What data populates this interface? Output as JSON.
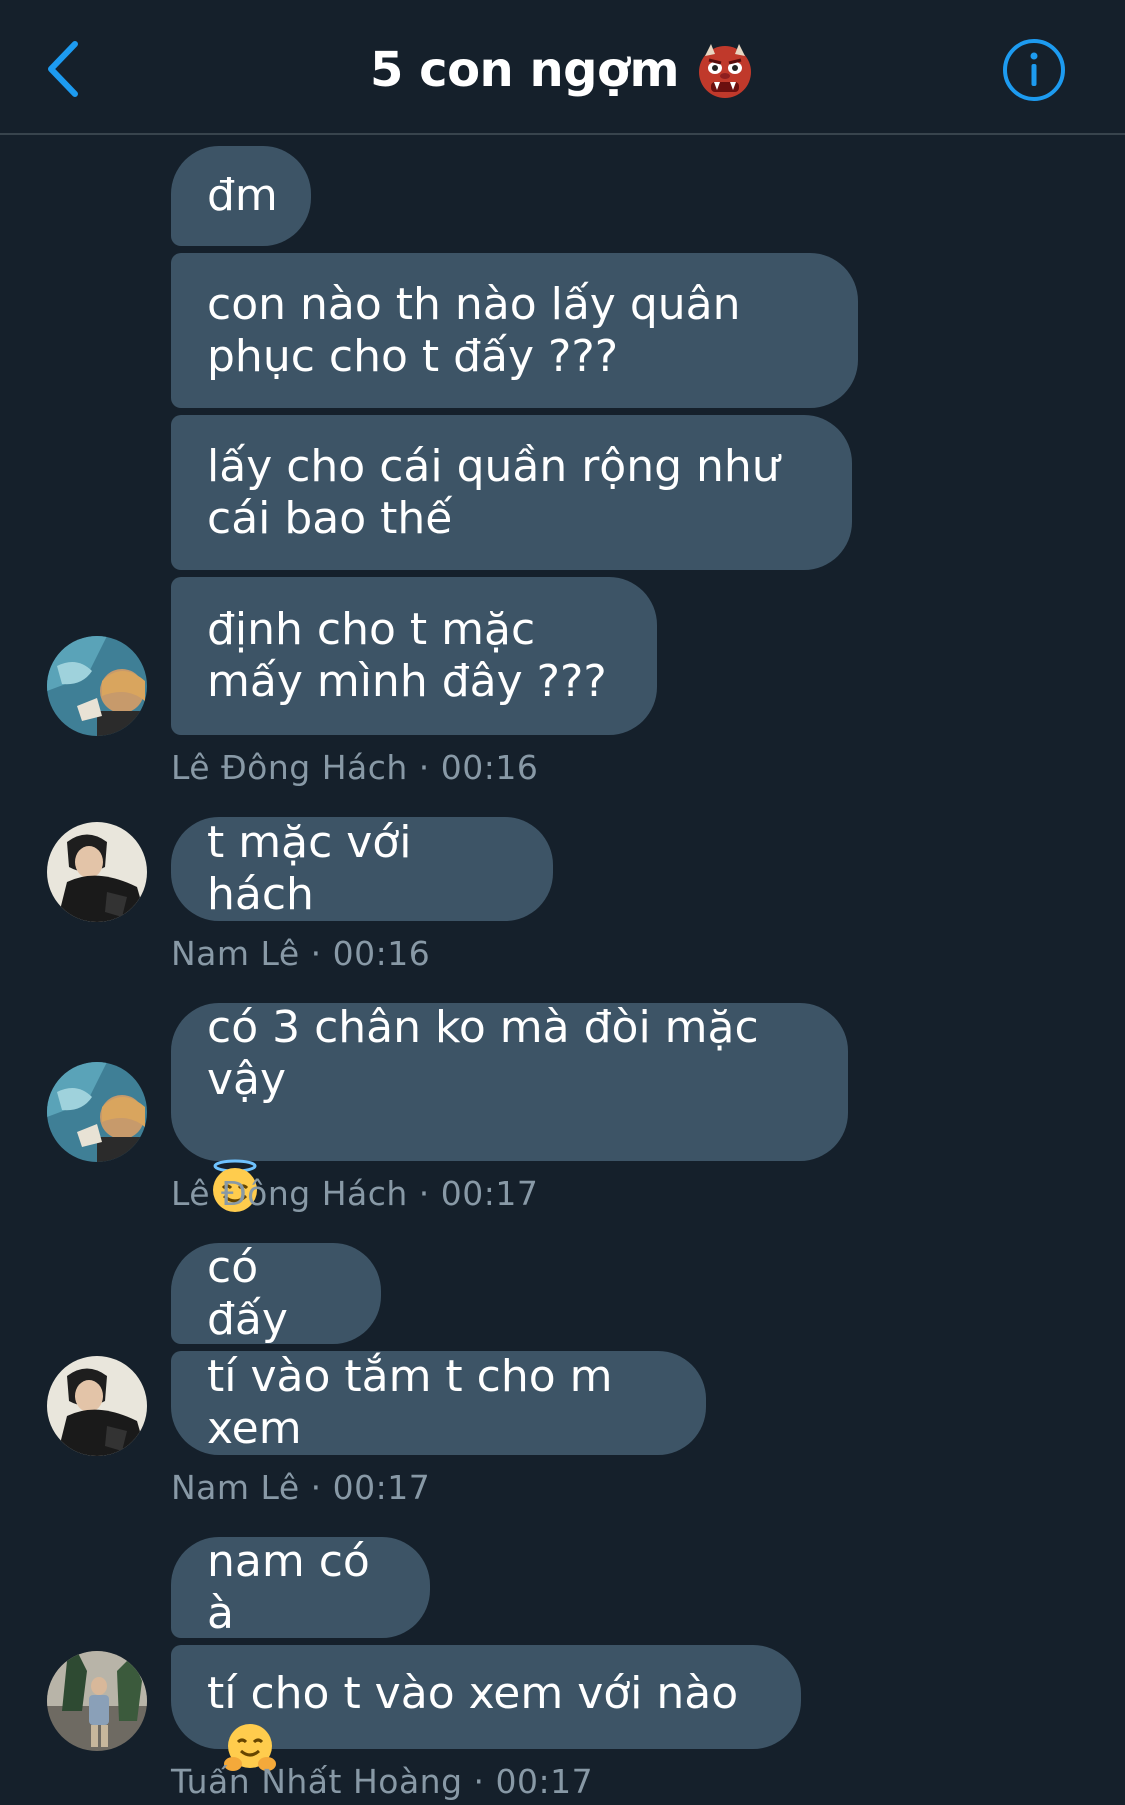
{
  "header": {
    "title": "5 con ngợm",
    "title_emoji": "ogre-emoji",
    "back_icon": "chevron-left-icon",
    "info_icon": "info-circle-icon",
    "accent_color": "#1d9bf0"
  },
  "messages": [
    {
      "text": "đm"
    },
    {
      "text": "con nào th nào lấy quân phục cho t đấy ???"
    },
    {
      "text": "lấy cho cái quần rộng như cái bao thế"
    },
    {
      "text": "định cho t mặc mấy mình đây ???"
    },
    {
      "meta": "Lê Đông Hách · 00:16"
    },
    {
      "text": "t mặc với hách"
    },
    {
      "meta": "Nam Lê · 00:16"
    },
    {
      "text": "có 3 chân ko mà đòi mặc vậy",
      "emoji": "smiling-face-with-halo-emoji"
    },
    {
      "meta": "Lê Đông Hách · 00:17"
    },
    {
      "text": "có đấy"
    },
    {
      "text": "tí vào tắm t cho m xem"
    },
    {
      "meta": "Nam Lê · 00:17"
    },
    {
      "text": "nam có à"
    },
    {
      "text": "tí cho t vào xem với nào",
      "emoji": "hugging-face-emoji"
    },
    {
      "meta": "Tuấn Nhất Hoàng · 00:17"
    }
  ],
  "colors": {
    "background": "#15202b",
    "bubble": "#3d5466",
    "meta_text": "#8899a6",
    "divider": "#38444d"
  }
}
